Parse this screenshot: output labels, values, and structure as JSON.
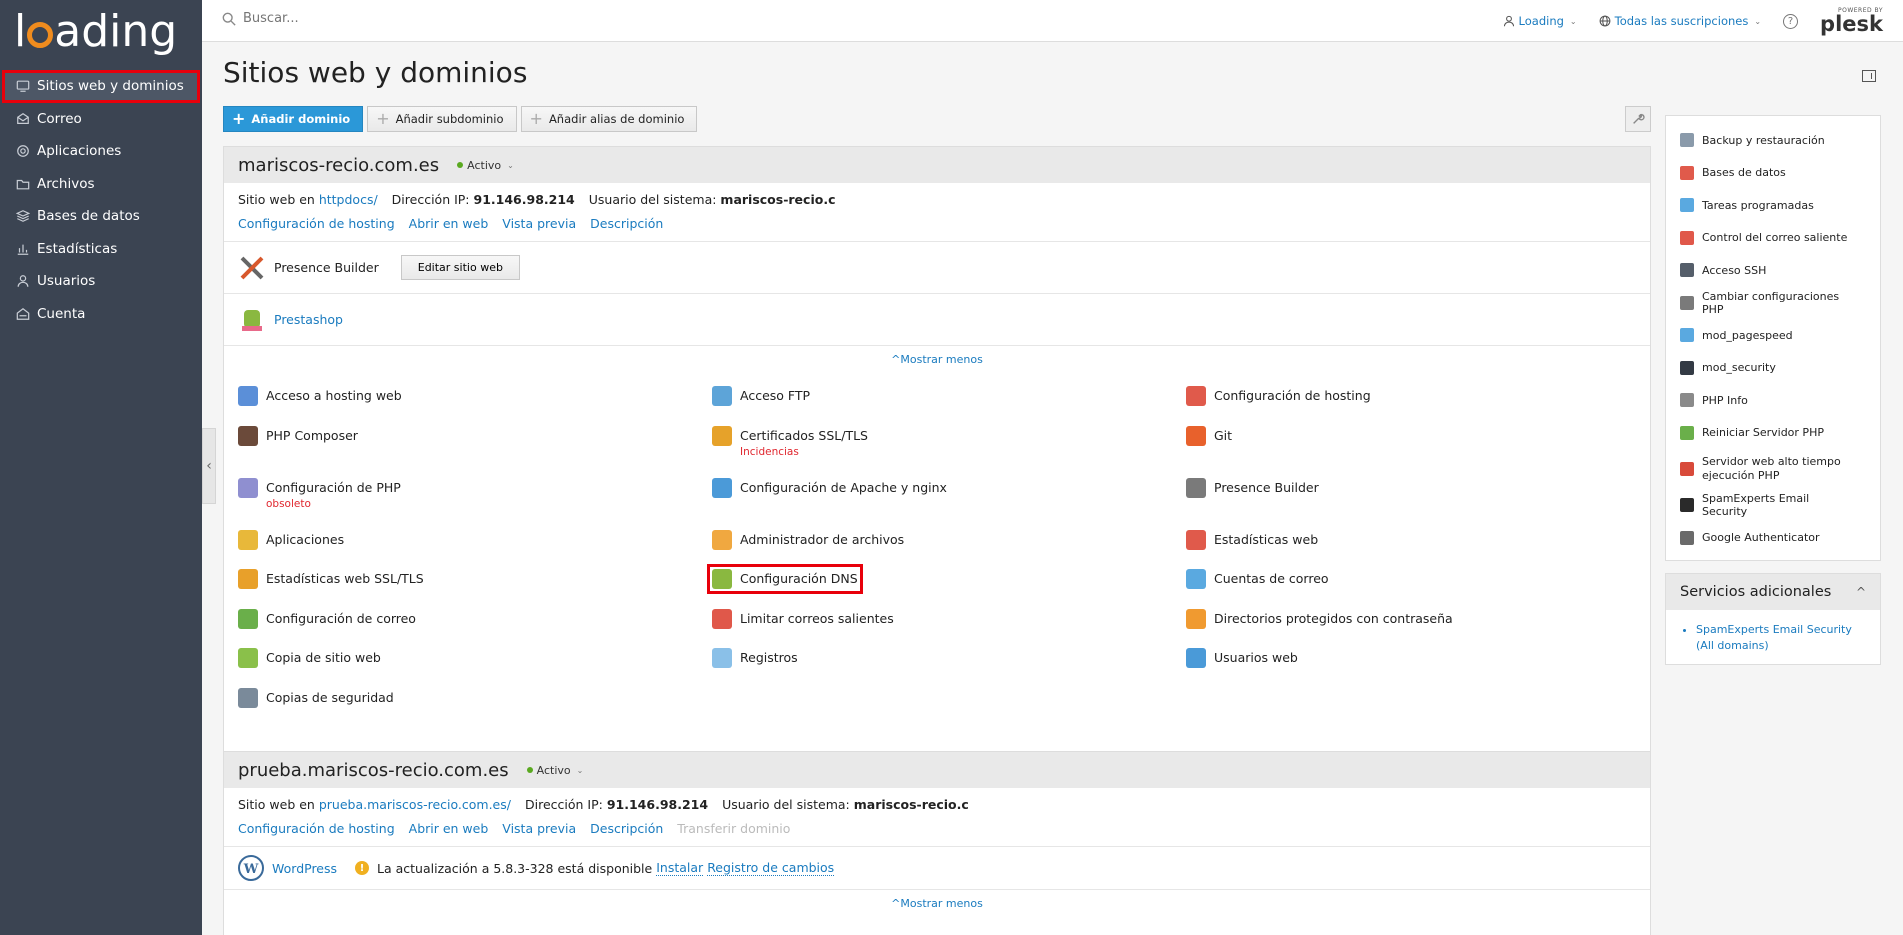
{
  "brand": {
    "logo_pre": "l",
    "logo_post": "ading",
    "powered_by": "POWERED BY",
    "plesk": "plesk"
  },
  "sidebar": {
    "items": [
      {
        "label": "Sitios web y dominios",
        "icon": "monitor-icon",
        "active": true
      },
      {
        "label": "Correo",
        "icon": "mail-icon"
      },
      {
        "label": "Aplicaciones",
        "icon": "gear-icon"
      },
      {
        "label": "Archivos",
        "icon": "folder-icon"
      },
      {
        "label": "Bases de datos",
        "icon": "layers-icon"
      },
      {
        "label": "Estadísticas",
        "icon": "bar-chart-icon"
      },
      {
        "label": "Usuarios",
        "icon": "user-icon"
      },
      {
        "label": "Cuenta",
        "icon": "account-icon"
      }
    ],
    "collapse_glyph": "‹"
  },
  "topbar": {
    "search_placeholder": "Buscar...",
    "user": "Loading",
    "subscriptions": "Todas las suscripciones",
    "help": "?"
  },
  "main": {
    "title": "Sitios web y dominios",
    "toolbar": {
      "add_domain": "Añadir dominio",
      "add_subdomain": "Añadir subdominio",
      "add_alias": "Añadir alias de dominio"
    }
  },
  "domains": [
    {
      "name": "mariscos-recio.com.es",
      "status": "Activo",
      "site_prefix": "Sitio web en",
      "site_path": "httpdocs/",
      "ip_label": "Dirección IP:",
      "ip": "91.146.98.214",
      "user_label": "Usuario del sistema:",
      "user": "mariscos-recio.c",
      "links": [
        "Configuración de hosting",
        "Abrir en web",
        "Vista previa",
        "Descripción"
      ],
      "presence_builder": "Presence Builder",
      "edit_site": "Editar sitio web",
      "prestashop": "Prestashop",
      "show_less": "Mostrar menos",
      "tools": [
        {
          "label": "Acceso a hosting web",
          "color": "#5b8fd8"
        },
        {
          "label": "Acceso FTP",
          "color": "#5da4d8"
        },
        {
          "label": "Configuración de hosting",
          "color": "#e05a4b"
        },
        {
          "label": "PHP Composer",
          "color": "#6b4a3a"
        },
        {
          "label": "Certificados SSL/TLS",
          "sub": "Incidencias",
          "color": "#e6a22a"
        },
        {
          "label": "Git",
          "color": "#e8612c"
        },
        {
          "label": "Configuración de PHP",
          "sub": "obsoleto",
          "color": "#8f8fd0"
        },
        {
          "label": "Configuración de Apache y nginx",
          "color": "#4b9ad8"
        },
        {
          "label": "Presence Builder",
          "color": "#7a7a7a"
        },
        {
          "label": "Aplicaciones",
          "color": "#e8b83a"
        },
        {
          "label": "Administrador de archivos",
          "color": "#f0a840"
        },
        {
          "label": "Estadísticas web",
          "color": "#e05a4b"
        },
        {
          "label": "Estadísticas web SSL/TLS",
          "color": "#e8a02a"
        },
        {
          "label": "Configuración DNS",
          "color": "#8ab840"
        },
        {
          "label": "Cuentas de correo",
          "color": "#5aa9e0"
        },
        {
          "label": "Configuración de correo",
          "color": "#6aaf4a"
        },
        {
          "label": "Limitar correos salientes",
          "color": "#e0584a"
        },
        {
          "label": "Directorios protegidos con contraseña",
          "color": "#f09a30"
        },
        {
          "label": "Copia de sitio web",
          "color": "#8ac04a"
        },
        {
          "label": "Registros",
          "color": "#8ac0e8"
        },
        {
          "label": "Usuarios web",
          "color": "#4a9ad8"
        },
        {
          "label": "Copias de seguridad",
          "color": "#7a8a9a"
        }
      ]
    },
    {
      "name": "prueba.mariscos-recio.com.es",
      "status": "Activo",
      "site_prefix": "Sitio web en",
      "site_path": "prueba.mariscos-recio.com.es/",
      "ip_label": "Dirección IP:",
      "ip": "91.146.98.214",
      "user_label": "Usuario del sistema:",
      "user": "mariscos-recio.c",
      "links": [
        "Configuración de hosting",
        "Abrir en web",
        "Vista previa",
        "Descripción"
      ],
      "disabled_link": "Transferir dominio",
      "wordpress": "WordPress",
      "update_notice": "La actualización a 5.8.3-328 está disponible",
      "install": "Instalar",
      "changelog": "Registro de cambios",
      "show_less": "Mostrar menos"
    }
  ],
  "right": {
    "items": [
      {
        "label": "Backup y restauración",
        "color": "#8a9aaa"
      },
      {
        "label": "Bases de datos",
        "color": "#e05a4b"
      },
      {
        "label": "Tareas programadas",
        "color": "#5aa9e0"
      },
      {
        "label": "Control del correo saliente",
        "color": "#e0584a"
      },
      {
        "label": "Acceso SSH",
        "color": "#555e6a"
      },
      {
        "label": "Cambiar configuraciones PHP",
        "color": "#7a7a7a"
      },
      {
        "label": "mod_pagespeed",
        "color": "#5aa9e0"
      },
      {
        "label": "mod_security",
        "color": "#333a44"
      },
      {
        "label": "PHP Info",
        "color": "#8a8a8a"
      },
      {
        "label": "Reiniciar Servidor PHP",
        "color": "#6aaf4a"
      },
      {
        "label": "Servidor web alto tiempo ejecución PHP",
        "color": "#d84a3a"
      },
      {
        "label": "SpamExperts Email Security",
        "color": "#2a2a2a"
      },
      {
        "label": "Google Authenticator",
        "color": "#6a6a6a"
      }
    ],
    "services_title": "Servicios adicionales",
    "services": [
      "SpamExperts Email Security (All domains)"
    ],
    "services_caret": "^"
  }
}
